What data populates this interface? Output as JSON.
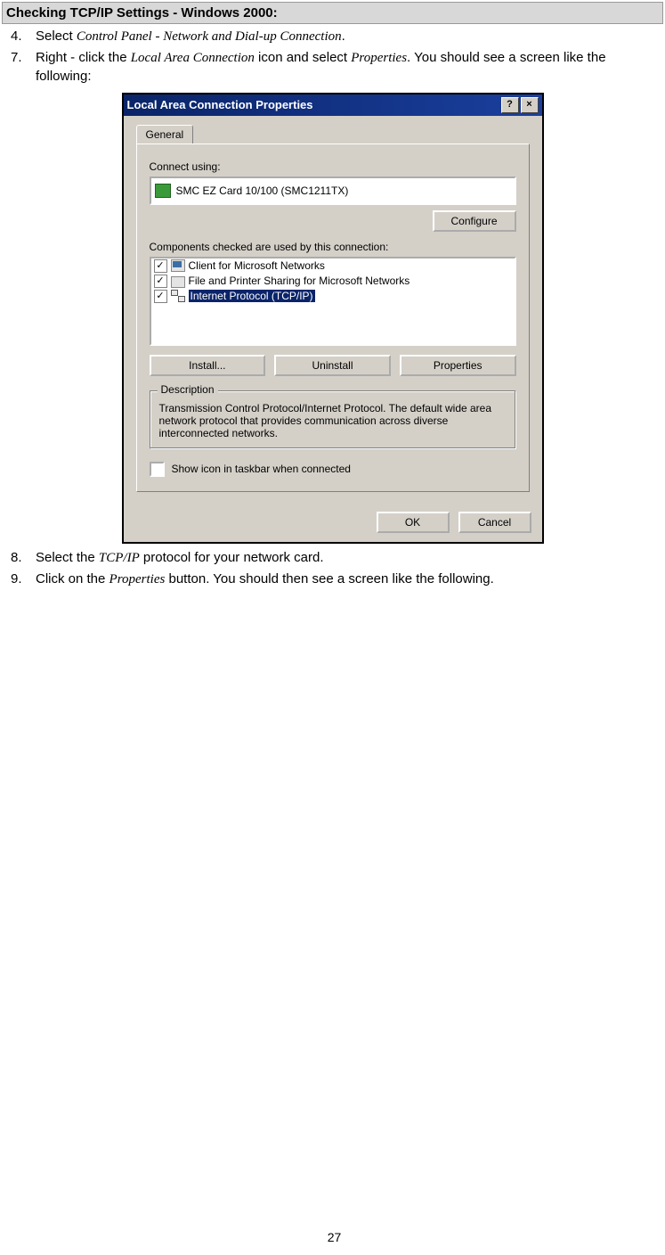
{
  "section_title": "Checking TCP/IP Settings - Windows 2000:",
  "steps": {
    "s4": {
      "num": "4.",
      "pre": "Select ",
      "i": "Control Panel - Network and Dial-up Connection",
      "post": "."
    },
    "s7": {
      "num": "7.",
      "pre": "Right - click the ",
      "i1": "Local Area Connection",
      "mid": " icon and select ",
      "i2": "Properties",
      "post": ". You should see a screen like the following:"
    },
    "s8": {
      "num": "8.",
      "pre": "Select the ",
      "i": "TCP/IP",
      "post": " protocol for your network card."
    },
    "s9": {
      "num": "9.",
      "pre": "Click on the ",
      "i": "Properties",
      "post": " button. You should then see a screen like the following."
    }
  },
  "dialog": {
    "title": "Local Area Connection Properties",
    "help": "?",
    "close": "×",
    "tab": "General",
    "connect_label": "Connect using:",
    "adapter": "SMC EZ Card 10/100 (SMC1211TX)",
    "configure": "Configure",
    "components_label": "Components checked are used by this connection:",
    "items": [
      "Client for Microsoft Networks",
      "File and Printer Sharing for Microsoft Networks",
      "Internet Protocol (TCP/IP)"
    ],
    "install": "Install...",
    "uninstall": "Uninstall",
    "properties": "Properties",
    "desc_title": "Description",
    "desc_text": "Transmission Control Protocol/Internet Protocol. The default wide area network protocol that provides communication across diverse interconnected networks.",
    "taskbar": "Show icon in taskbar when connected",
    "ok": "OK",
    "cancel": "Cancel"
  },
  "page_number": "27"
}
